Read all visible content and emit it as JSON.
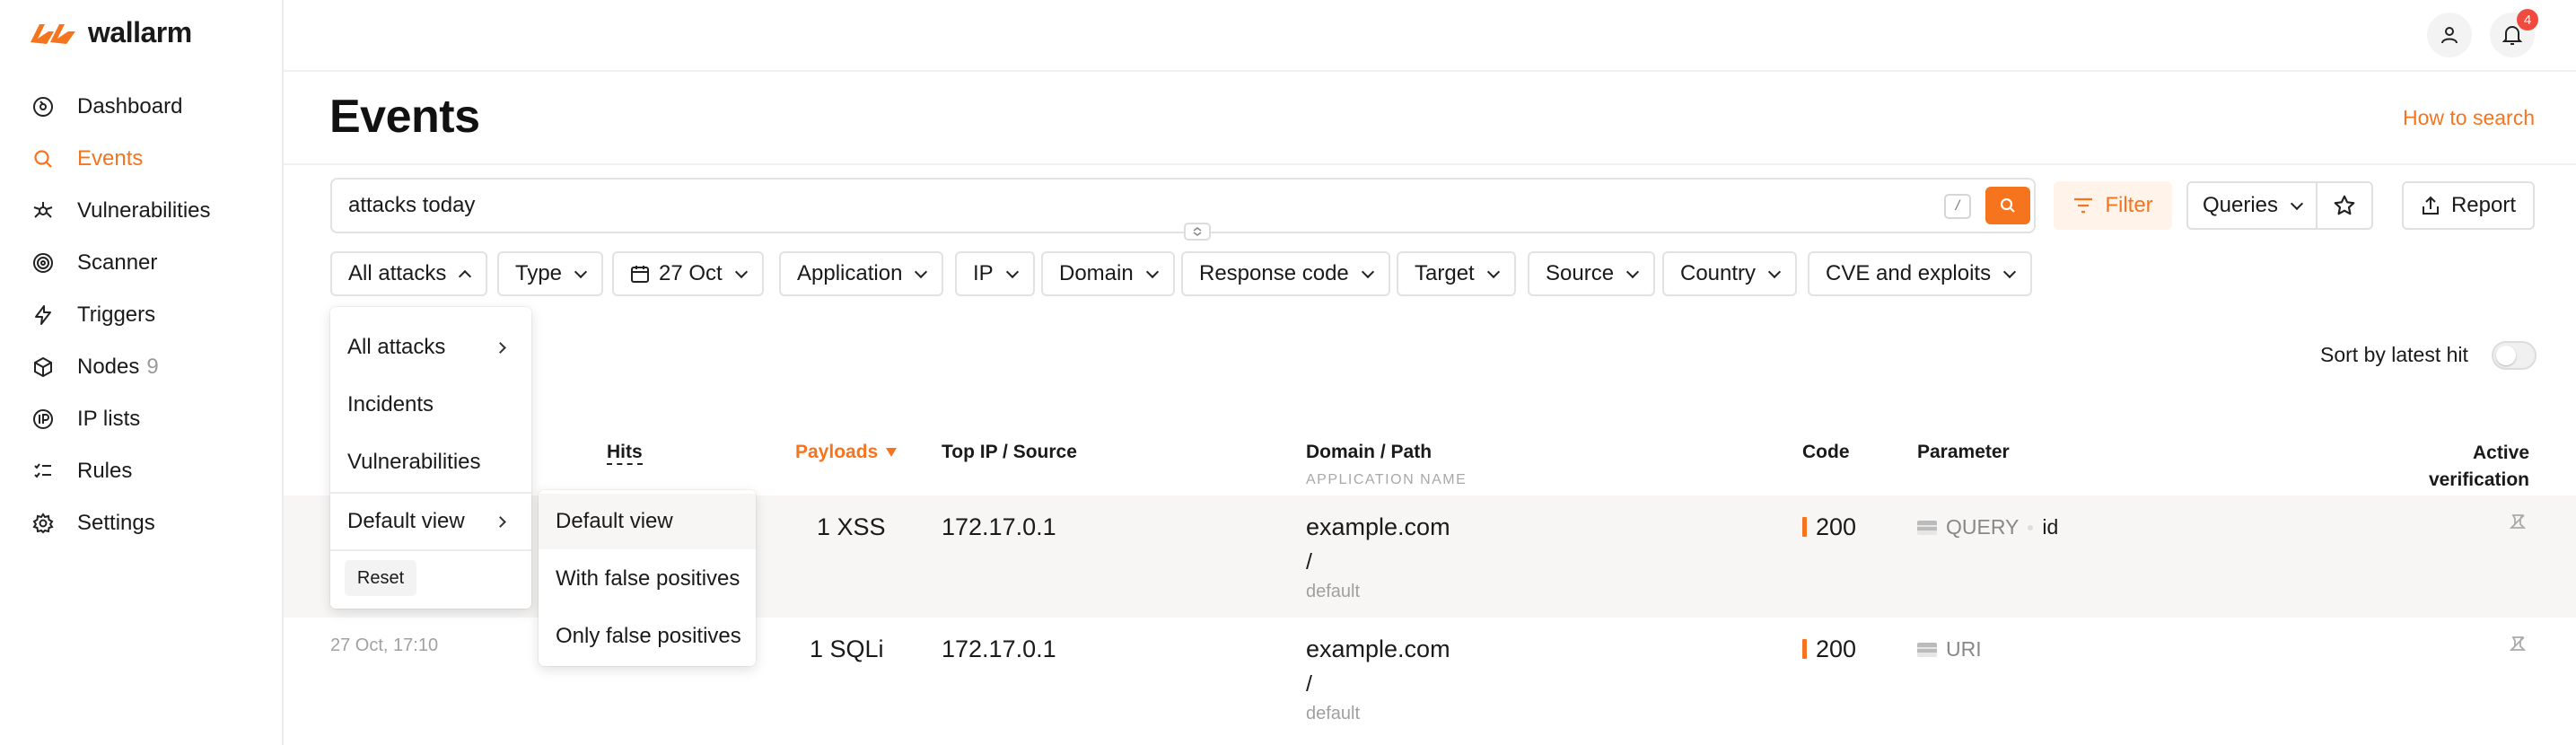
{
  "app": {
    "brand": "wallarm"
  },
  "sidebar": {
    "items": [
      {
        "label": "Dashboard",
        "icon": "dashboard-icon"
      },
      {
        "label": "Events",
        "icon": "search-icon",
        "active": true
      },
      {
        "label": "Vulnerabilities",
        "icon": "bug-icon"
      },
      {
        "label": "Scanner",
        "icon": "scanner-icon"
      },
      {
        "label": "Triggers",
        "icon": "lightning-icon"
      },
      {
        "label": "Nodes",
        "icon": "nodes-icon",
        "count": "9"
      },
      {
        "label": "IP lists",
        "icon": "ip-icon"
      },
      {
        "label": "Rules",
        "icon": "rules-icon"
      },
      {
        "label": "Settings",
        "icon": "gear-icon"
      }
    ]
  },
  "header": {
    "notifications_count": "4"
  },
  "page": {
    "title": "Events",
    "how_to_search": "How to search"
  },
  "search": {
    "query": "attacks today",
    "shortcut": "/"
  },
  "toolbar": {
    "filter_label": "Filter",
    "queries_label": "Queries",
    "report_label": "Report"
  },
  "filters": [
    "All attacks",
    "Type",
    "27 Oct",
    "Application",
    "IP",
    "Domain",
    "Response code",
    "Target",
    "Source",
    "Country",
    "CVE and exploits"
  ],
  "sort": {
    "label": "Sort by latest hit",
    "enabled": false
  },
  "table": {
    "columns": {
      "hits": "Hits",
      "payloads": "Payloads",
      "top_ip": "Top IP / Source",
      "domain": "Domain / Path",
      "domain_sub": "APPLICATION NAME",
      "code": "Code",
      "parameter": "Parameter",
      "active_verification_1": "Active",
      "active_verification_2": "verification"
    },
    "rows": [
      {
        "time": "",
        "payloads": "1 XSS",
        "ip": "172.17.0.1",
        "domain": "example.com",
        "path": "/",
        "app": "default",
        "code": "200",
        "param_type": "QUERY",
        "param_name": "id"
      },
      {
        "time": "27 Oct, 17:10",
        "payloads": "1 SQLi",
        "ip": "172.17.0.1",
        "domain": "example.com",
        "path": "/",
        "app": "default",
        "code": "200",
        "param_type": "URI",
        "param_name": ""
      }
    ]
  },
  "attacks_menu": {
    "items": [
      "All attacks",
      "Incidents",
      "Vulnerabilities",
      "Default view"
    ],
    "reset_label": "Reset"
  },
  "view_submenu": {
    "items": [
      "Default view",
      "With false positives",
      "Only false positives"
    ]
  },
  "colors": {
    "accent": "#f7741e",
    "badge": "#f04b3e"
  }
}
